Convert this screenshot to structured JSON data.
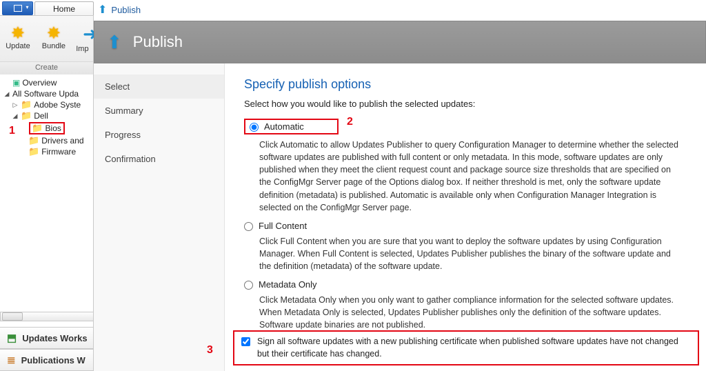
{
  "top": {
    "home_tab": "Home"
  },
  "ribbon": {
    "update": "Update",
    "bundle": "Bundle",
    "import": "Imp",
    "group": "Create"
  },
  "breadcrumb": {
    "label": "Publish"
  },
  "banner": {
    "title": "Publish"
  },
  "tree": {
    "overview": "Overview",
    "all_updates": "All Software Upda",
    "adobe": "Adobe Syste",
    "dell": "Dell",
    "bios": "Bios",
    "drivers": "Drivers and",
    "firmware": "Firmware"
  },
  "bottom_nav": {
    "updates": "Updates Works",
    "publications": "Publications W"
  },
  "wizard_steps": [
    "Select",
    "Summary",
    "Progress",
    "Confirmation"
  ],
  "main": {
    "title": "Specify publish options",
    "instruction": "Select how you would like to publish the selected updates:",
    "options": {
      "automatic": {
        "label": "Automatic",
        "desc": "Click Automatic to allow Updates Publisher to query  Configuration Manager to determine whether the selected software updates are published with full content or only metadata. In this mode, software updates are only published when they meet the client request count and package source size thresholds that are specified on the ConfigMgr Server page of the Options dialog box. If neither threshold is met, only the software update definition (metadata) is published. Automatic is available only when Configuration Manager Integration is selected on the ConfigMgr Server page."
      },
      "full": {
        "label": "Full Content",
        "desc": "Click Full Content when you are sure that you want to deploy the software updates by using Configuration Manager. When Full Content is selected, Updates Publisher publishes the binary of the software update and the definition (metadata) of the software update."
      },
      "metadata": {
        "label": "Metadata Only",
        "desc": "Click Metadata Only when you only want to gather compliance information for the selected software updates. When Metadata Only is selected, Updates Publisher publishes only the definition of the software updates. Software update binaries are not published."
      }
    },
    "sign_text": "Sign all software updates with a new publishing certificate when published software updates have not changed but their certificate has changed."
  },
  "annotations": {
    "n1": "1",
    "n2": "2",
    "n3": "3"
  }
}
